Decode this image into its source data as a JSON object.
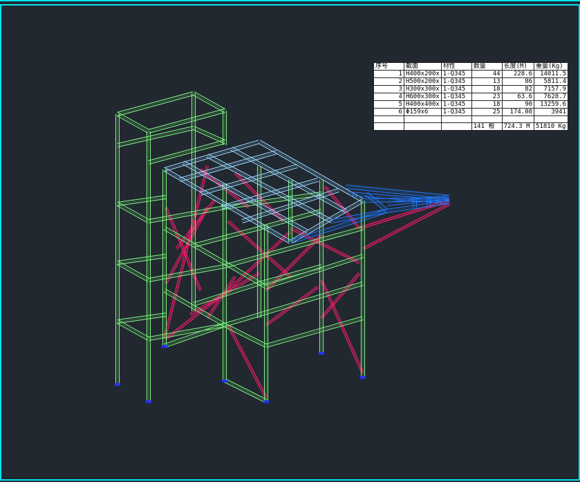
{
  "viewport": {
    "background": "#212830",
    "frame_color": "#00e5ee",
    "column_color": "#7cf27c",
    "beam_color": "#1f78ff",
    "brace_color": "#ff1a6e",
    "top_beam_color": "#9ad8ff",
    "base_color": "#2233ff"
  },
  "bom": {
    "headers": [
      "序号",
      "截面",
      "材性",
      "数量",
      "长度(M)",
      "重量(Kg)"
    ],
    "rows": [
      {
        "no": "1",
        "section": "H400x200x",
        "material": "1-Q345",
        "qty": "44",
        "length": "228.6",
        "weight": "14011.5"
      },
      {
        "no": "2",
        "section": "H500x200x",
        "material": "1-Q345",
        "qty": "13",
        "length": "86",
        "weight": "5811.4"
      },
      {
        "no": "3",
        "section": "H300x300x",
        "material": "1-Q345",
        "qty": "18",
        "length": "82",
        "weight": "7157.9"
      },
      {
        "no": "4",
        "section": "H600x300x",
        "material": "1-Q345",
        "qty": "23",
        "length": "63.6",
        "weight": "7628.7"
      },
      {
        "no": "5",
        "section": "H400x400x",
        "material": "1-Q345",
        "qty": "18",
        "length": "90",
        "weight": "13259.6"
      },
      {
        "no": "6",
        "section": "Φ159x6",
        "material": "1-Q345",
        "qty": "25",
        "length": "174.08",
        "weight": "3941"
      }
    ],
    "totals": {
      "qty": "141 根",
      "length": "724.3 M",
      "weight": "51810 Kg"
    }
  }
}
